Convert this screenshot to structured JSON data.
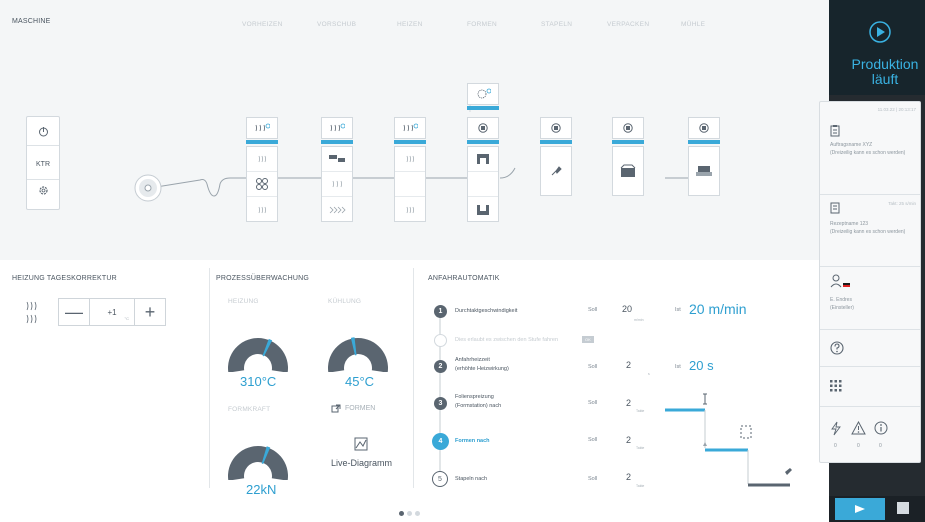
{
  "machine": {
    "title": "MASCHINE",
    "stages": [
      "VORHEIZEN",
      "VORSCHUB",
      "HEIZEN",
      "FORMEN",
      "STAPELN",
      "VERPACKEN",
      "MÜHLE"
    ],
    "ktr_label": "KTR"
  },
  "heating": {
    "title": "HEIZUNG TAGESKORREKTUR",
    "minus": "—",
    "value": "+1",
    "unit": "°C",
    "plus": "+"
  },
  "process": {
    "title": "PROZESSÜBERWACHUNG",
    "heating_label": "HEIZUNG",
    "heating_value": "310°C",
    "cooling_label": "KÜHLUNG",
    "cooling_value": "45°C",
    "force_label": "FORMKRAFT",
    "force_value": "22kN",
    "forms_link": "FORMEN",
    "live_label": "Live-Diagramm",
    "heating_level": 0.62,
    "cooling_level": 0.45,
    "force_level": 0.6
  },
  "startup": {
    "title": "ANFAHRAUTOMATIK",
    "soll_label": "Soll",
    "ist_label": "Ist",
    "steps": [
      {
        "num": "1",
        "label": "Durchtaktgeschwindigkeit",
        "soll": "20",
        "unit": "m/min",
        "ist": "20 m/min"
      },
      {
        "num": "",
        "label": "Dies erlaubt es zwischen den Stufe fahren",
        "tag": "OK"
      },
      {
        "num": "2",
        "label": "Anfahrheizzeit\n(erhöhte Heizwirkung)",
        "soll": "2",
        "unit": "s",
        "ist": "20 s"
      },
      {
        "num": "3",
        "label": "Folienspreizung\n(Formstation) nach",
        "soll": "2",
        "unit": "Takte"
      },
      {
        "num": "4",
        "label": "Formen nach",
        "soll": "2",
        "unit": "Takte"
      },
      {
        "num": "5",
        "label": "Stapeln nach",
        "soll": "2",
        "unit": "Takte"
      }
    ]
  },
  "sidebar": {
    "status": "Produktion\nläuft",
    "timestamp": "11.03.22 | 20:13:17",
    "order_name": "Auftragsname XYZ",
    "order_note": "(Dreizeilig kann es schon werden)",
    "takt": "Takt: 25 s/min",
    "recipe_name": "Rezeptname 123",
    "recipe_note": "(Dreizeilig kann es schon werden)",
    "user_name": "E. Endres",
    "user_role": "(Einsteller)",
    "counts": [
      "0",
      "0",
      "0"
    ]
  },
  "colors": {
    "accent": "#3aa9d8",
    "gauge_dark": "#5a6570",
    "sidebar_bg": "#252b30"
  }
}
